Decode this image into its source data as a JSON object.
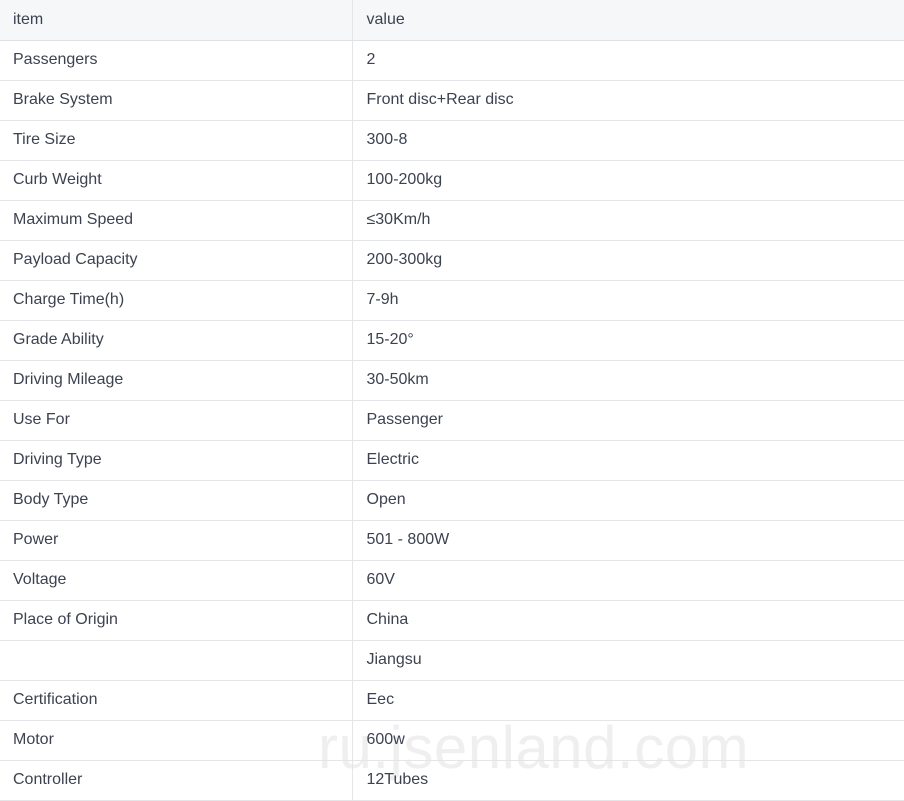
{
  "table": {
    "columns": [
      "item",
      "value"
    ],
    "rows": [
      {
        "item": "Passengers",
        "value": "2"
      },
      {
        "item": "Brake System",
        "value": "Front disc+Rear disc"
      },
      {
        "item": "Tire Size",
        "value": "300-8"
      },
      {
        "item": "Curb Weight",
        "value": "100-200kg"
      },
      {
        "item": "Maximum Speed",
        "value": "≤30Km/h"
      },
      {
        "item": "Payload Capacity",
        "value": "200-300kg"
      },
      {
        "item": "Charge Time(h)",
        "value": "7-9h"
      },
      {
        "item": "Grade Ability",
        "value": "15-20°"
      },
      {
        "item": "Driving Mileage",
        "value": "30-50km"
      },
      {
        "item": "Use For",
        "value": "Passenger"
      },
      {
        "item": "Driving Type",
        "value": "Electric"
      },
      {
        "item": "Body Type",
        "value": "Open"
      },
      {
        "item": "Power",
        "value": "501 - 800W"
      },
      {
        "item": "Voltage",
        "value": "60V"
      },
      {
        "item": "Place of Origin",
        "value": "China"
      },
      {
        "item": "",
        "value": "Jiangsu"
      },
      {
        "item": "Certification",
        "value": "Eec"
      },
      {
        "item": "Motor",
        "value": "600w"
      },
      {
        "item": "Controller",
        "value": "12Tubes"
      }
    ]
  },
  "watermark": {
    "text": "ru.jsenland.com"
  },
  "colors": {
    "header_background": "#f6f7f8",
    "border": "#e4e5e7",
    "text": "#3c4250",
    "watermark": "#efeff0",
    "page_background": "#ffffff"
  }
}
